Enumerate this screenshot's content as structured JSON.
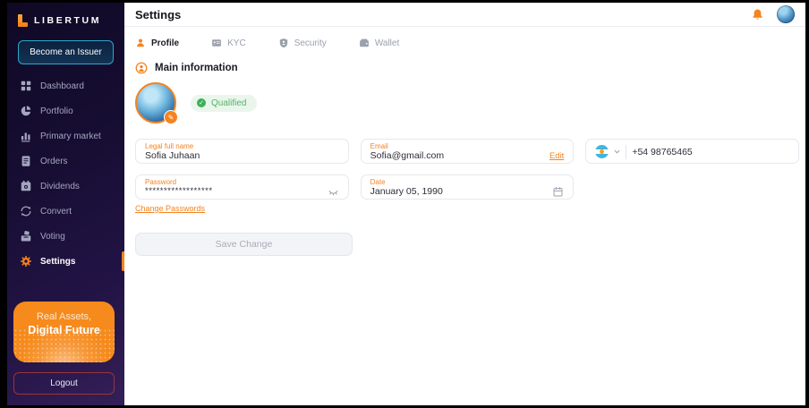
{
  "brand": {
    "logo_text": "LIBERTUM"
  },
  "colors": {
    "accent_orange": "#F5831F",
    "teal_border": "#2BA7C9",
    "success_green": "#3DB058",
    "logout_red": "#9E3339",
    "sidebar_dark": "#170E33"
  },
  "sidebar": {
    "issuer_button_label": "Become an Issuer",
    "nav_items": [
      {
        "label": "Dashboard",
        "icon": "dashboard-icon",
        "active": false
      },
      {
        "label": "Portfolio",
        "icon": "portfolio-icon",
        "active": false
      },
      {
        "label": "Primary market",
        "icon": "primary-market-icon",
        "active": false
      },
      {
        "label": "Orders",
        "icon": "orders-icon",
        "active": false
      },
      {
        "label": "Dividends",
        "icon": "dividends-icon",
        "active": false
      },
      {
        "label": "Convert",
        "icon": "convert-icon",
        "active": false
      },
      {
        "label": "Voting",
        "icon": "voting-icon",
        "active": false
      },
      {
        "label": "Settings",
        "icon": "settings-gear-icon",
        "active": true
      }
    ],
    "promo_card": {
      "line1": "Real Assets,",
      "line2": "Digital Future"
    },
    "logout_label": "Logout"
  },
  "header": {
    "title": "Settings"
  },
  "tabs": [
    {
      "label": "Profile",
      "icon": "profile-icon",
      "active": true
    },
    {
      "label": "KYC",
      "icon": "id-card-icon",
      "active": false
    },
    {
      "label": "Security",
      "icon": "shield-icon",
      "active": false
    },
    {
      "label": "Wallet",
      "icon": "wallet-icon",
      "active": false
    }
  ],
  "profile": {
    "section_title": "Main information",
    "qualified_badge_label": "Qualified",
    "fields": {
      "legal_name": {
        "label": "Legal full name",
        "value": "Sofia Juhaan"
      },
      "email": {
        "label": "Email",
        "value": "Sofia@gmail.com",
        "action_label": "Edit"
      },
      "phone": {
        "flag": "argentina-flag-icon",
        "value": "+54 98765465"
      },
      "password": {
        "label": "Password",
        "value": "******************"
      },
      "birth_date": {
        "label": "Date",
        "value": "January 05, 1990"
      }
    },
    "change_password_label": "Change Passwords",
    "save_button_label": "Save Change"
  }
}
